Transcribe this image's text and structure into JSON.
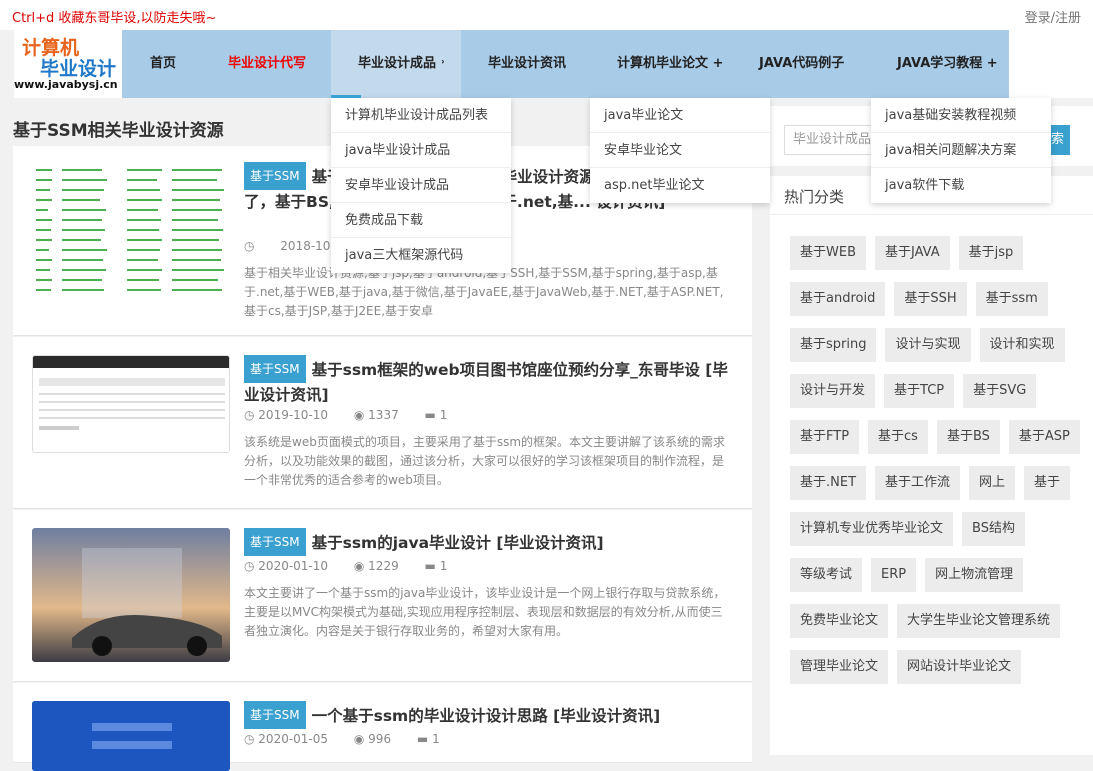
{
  "topbar": {
    "tip": "Ctrl+d 收藏东哥毕设,以防走失哦~",
    "login": "登录/注册"
  },
  "logo": {
    "line1": "计算机",
    "line2": "毕业设计",
    "line3": "www.javabysj.cn"
  },
  "nav": {
    "items": [
      {
        "label": "首页"
      },
      {
        "label": "毕业设计代写"
      },
      {
        "label": "毕业设计成品 ˒"
      },
      {
        "label": "毕业设计资讯"
      },
      {
        "label": "计算机毕业论文 +"
      },
      {
        "label": "JAVA代码例子"
      },
      {
        "label": "JAVA学习教程 +"
      }
    ]
  },
  "dropdowns": {
    "products": [
      "计算机毕业设计成品列表",
      "java毕业设计成品",
      "安卓毕业设计成品",
      "免费成品下载",
      "java三大框架源代码"
    ],
    "thesis": [
      "java毕业论文",
      "安卓毕业论文",
      "asp.net毕业论文"
    ],
    "tutorial": [
      "java基础安装教程视频",
      "java相关问题解决方案",
      "java软件下载"
    ]
  },
  "main": {
    "section_title": "基于SSM相关毕业设计资源",
    "posts": [
      {
        "category": "基于SSM",
        "title": "基于SSM,基于... 基于相关毕业设计资源,基于jsp,基于... 了，基于BS,... 基于SSM,基于... 基于.net,基... 设计资讯]",
        "date": "2018-10-10",
        "views": "",
        "comments": "",
        "desc": "基于相关毕业设计资源,基于jsp,基于android,基于SSH,基于SSM,基于spring,基于asp,基于.net,基于WEB,基于java,基于微信,基于JavaEE,基于JavaWeb,基于.NET,基于ASP.NET,基于cs,基于JSP,基于J2EE,基于安卓"
      },
      {
        "category": "基于SSM",
        "title": "基于ssm框架的web项目图书馆座位预约分享_东哥毕设 [毕业设计资讯]",
        "date": "2019-10-10",
        "views": "1337",
        "comments": "1",
        "desc": "该系统是web页面模式的项目，主要采用了基于ssm的框架。本文主要讲解了该系统的需求分析，以及功能效果的截图，通过该分析，大家可以很好的学习该框架项目的制作流程，是一个非常优秀的适合参考的web项目。"
      },
      {
        "category": "基于SSM",
        "title": "基于ssm的java毕业设计 [毕业设计资讯]",
        "date": "2020-01-10",
        "views": "1229",
        "comments": "1",
        "desc": "本文主要讲了一个基于ssm的java毕业设计，该毕业设计是一个网上银行存取与贷款系统，主要是以MVC构架模式为基础,实现应用程序控制层、表现层和数据层的有效分析,从而使三者独立演化。内容是关于银行存取业务的，希望对大家有用。"
      },
      {
        "category": "基于SSM",
        "title": "一个基于ssm的毕业设计设计思路 [毕业设计资讯]",
        "date": "2020-01-05",
        "views": "996",
        "comments": "1",
        "desc": ""
      }
    ]
  },
  "sidebar": {
    "search_placeholder": "毕业设计成品",
    "search_button": "搜索",
    "hot_title": "热门分类",
    "tags": [
      "基于WEB",
      "基于JAVA",
      "基于jsp",
      "基于android",
      "基于SSH",
      "基于ssm",
      "基于spring",
      "设计与实现",
      "设计和实现",
      "设计与开发",
      "基于TCP",
      "基于SVG",
      "基于FTP",
      "基于cs",
      "基于BS",
      "基于ASP",
      "基于.NET",
      "基于工作流",
      "网上",
      "基于",
      "计算机专业优秀毕业论文",
      "BS结构",
      "等级考试",
      "ERP",
      "网上物流管理",
      "免费毕业论文",
      "大学生毕业论文管理系统",
      "管理毕业论文",
      "网站设计毕业论文"
    ]
  },
  "colors": {
    "nav_bg": "#a8cbe8",
    "accent": "#3aa0d0",
    "red": "#e00000"
  }
}
